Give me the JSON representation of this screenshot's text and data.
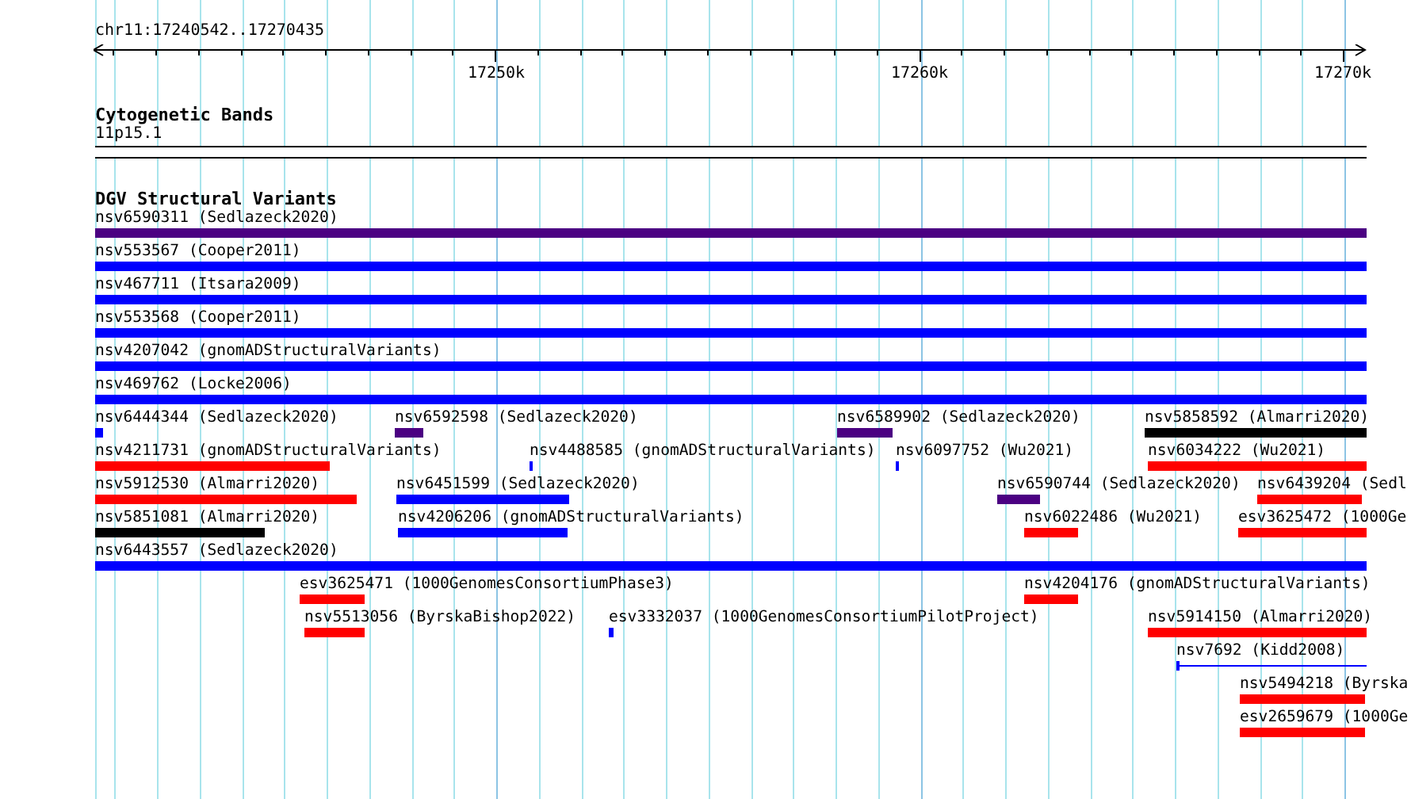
{
  "ruler": {
    "location": "chr11:17240542..17270435",
    "ticks": [
      {
        "label": "17250k"
      },
      {
        "label": "17260k"
      },
      {
        "label": "17270k"
      }
    ]
  },
  "tracks": [
    {
      "kind": "cytoband",
      "title": "Cytogenetic Bands",
      "bands": [
        {
          "name": "11p15.1"
        }
      ]
    },
    {
      "kind": "variants",
      "title": "DGV Structural Variants",
      "features": [
        {
          "kind": "bar",
          "label": "nsv6590311 (Sedlazeck2020)",
          "color": "#4b0082"
        },
        {
          "kind": "bar",
          "label": "nsv553567 (Cooper2011)",
          "color": "#0000ff"
        },
        {
          "kind": "bar",
          "label": "nsv467711 (Itsara2009)",
          "color": "#0000ff"
        },
        {
          "kind": "bar",
          "label": "nsv553568 (Cooper2011)",
          "color": "#0000ff"
        },
        {
          "kind": "bar",
          "label": "nsv4207042 (gnomADStructuralVariants)",
          "color": "#0000ff"
        },
        {
          "kind": "bar",
          "label": "nsv469762 (Locke2006)",
          "color": "#0000ff"
        },
        {
          "kind": "bar",
          "label": "nsv6444344 (Sedlazeck2020)",
          "color": "#0000ff"
        },
        {
          "kind": "bar",
          "label": "nsv6592598 (Sedlazeck2020)",
          "color": "#4b0082"
        },
        {
          "kind": "bar",
          "label": "nsv6589902 (Sedlazeck2020)",
          "color": "#4b0082"
        },
        {
          "kind": "bar",
          "label": "nsv5858592 (Almarri2020)",
          "color": "#000000"
        },
        {
          "kind": "bar",
          "label": "nsv4211731 (gnomADStructuralVariants)",
          "color": "#ff0000"
        },
        {
          "kind": "bar",
          "label": "nsv4488585 (gnomADStructuralVariants)",
          "color": "#0000ff"
        },
        {
          "kind": "bar",
          "label": "nsv6097752 (Wu2021)",
          "color": "#0000ff"
        },
        {
          "kind": "bar",
          "label": "nsv6034222 (Wu2021)",
          "color": "#ff0000"
        },
        {
          "kind": "bar",
          "label": "nsv5912530 (Almarri2020)",
          "color": "#ff0000"
        },
        {
          "kind": "bar",
          "label": "nsv6451599 (Sedlazeck2020)",
          "color": "#0000ff"
        },
        {
          "kind": "bar",
          "label": "nsv6590744 (Sedlazeck2020)",
          "color": "#4b0082"
        },
        {
          "kind": "bar",
          "label": "nsv6439204 (Sedl",
          "color": "#ff0000"
        },
        {
          "kind": "bar",
          "label": "nsv5851081 (Almarri2020)",
          "color": "#000000"
        },
        {
          "kind": "bar",
          "label": "nsv4206206 (gnomADStructuralVariants)",
          "color": "#0000ff"
        },
        {
          "kind": "bar",
          "label": "nsv6022486 (Wu2021)",
          "color": "#ff0000"
        },
        {
          "kind": "bar",
          "label": "esv3625472 (1000Ge",
          "color": "#ff0000"
        },
        {
          "kind": "bar",
          "label": "nsv6443557 (Sedlazeck2020)",
          "color": "#0000ff"
        },
        {
          "kind": "bar",
          "label": "esv3625471 (1000GenomesConsortiumPhase3)",
          "color": "#ff0000"
        },
        {
          "kind": "bar",
          "label": "nsv4204176 (gnomADStructuralVariants)",
          "color": "#ff0000"
        },
        {
          "kind": "bar",
          "label": "nsv5513056 (ByrskaBishop2022)",
          "color": "#ff0000"
        },
        {
          "kind": "bar",
          "label": "esv3332037 (1000GenomesConsortiumPilotProject)",
          "color": "#0000ff"
        },
        {
          "kind": "bar",
          "label": "nsv5914150 (Almarri2020)",
          "color": "#ff0000"
        },
        {
          "kind": "line",
          "label": "nsv7692 (Kidd2008)",
          "color": "#0000ff"
        },
        {
          "kind": "bar",
          "label": "nsv5494218 (Byrska",
          "color": "#ff0000"
        },
        {
          "kind": "bar",
          "label": "esv2659679 (1000Ge",
          "color": "#ff0000"
        }
      ]
    }
  ]
}
